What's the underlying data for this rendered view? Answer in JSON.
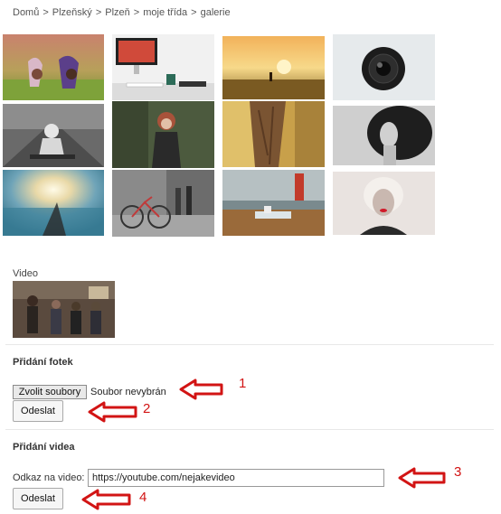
{
  "breadcrumb": {
    "items": [
      "Domů",
      "Plzeňský",
      "Plzeň",
      "moje třída",
      "galerie"
    ],
    "separator": ">"
  },
  "gallery": {
    "photos": [
      {
        "name": "girls-in-field"
      },
      {
        "name": "desk-computer-mug"
      },
      {
        "name": "sunset-field-person"
      },
      {
        "name": "camera-lens"
      },
      {
        "name": "child-on-road"
      },
      {
        "name": "woman-portrait"
      },
      {
        "name": "tree-trunk"
      },
      {
        "name": "woman-curly-hair"
      },
      {
        "name": "sun-over-sea"
      },
      {
        "name": "bicycles-street"
      },
      {
        "name": "cafe-table"
      },
      {
        "name": "marilyn-portrait"
      }
    ]
  },
  "video_section": {
    "label": "Video",
    "thumbnail": "band-video-thumbnail"
  },
  "photo_upload": {
    "title": "Přidání fotek",
    "file_button": "Zvolit soubory",
    "file_status": "Soubor nevybrán",
    "submit": "Odeslat"
  },
  "video_upload": {
    "title": "Přidání videa",
    "link_label": "Odkaz na video:",
    "link_value": "https://youtube.com/nejakevideo",
    "submit": "Odeslat"
  },
  "annotations": {
    "color": "#d21414",
    "labels": [
      "1",
      "2",
      "3",
      "4"
    ]
  }
}
